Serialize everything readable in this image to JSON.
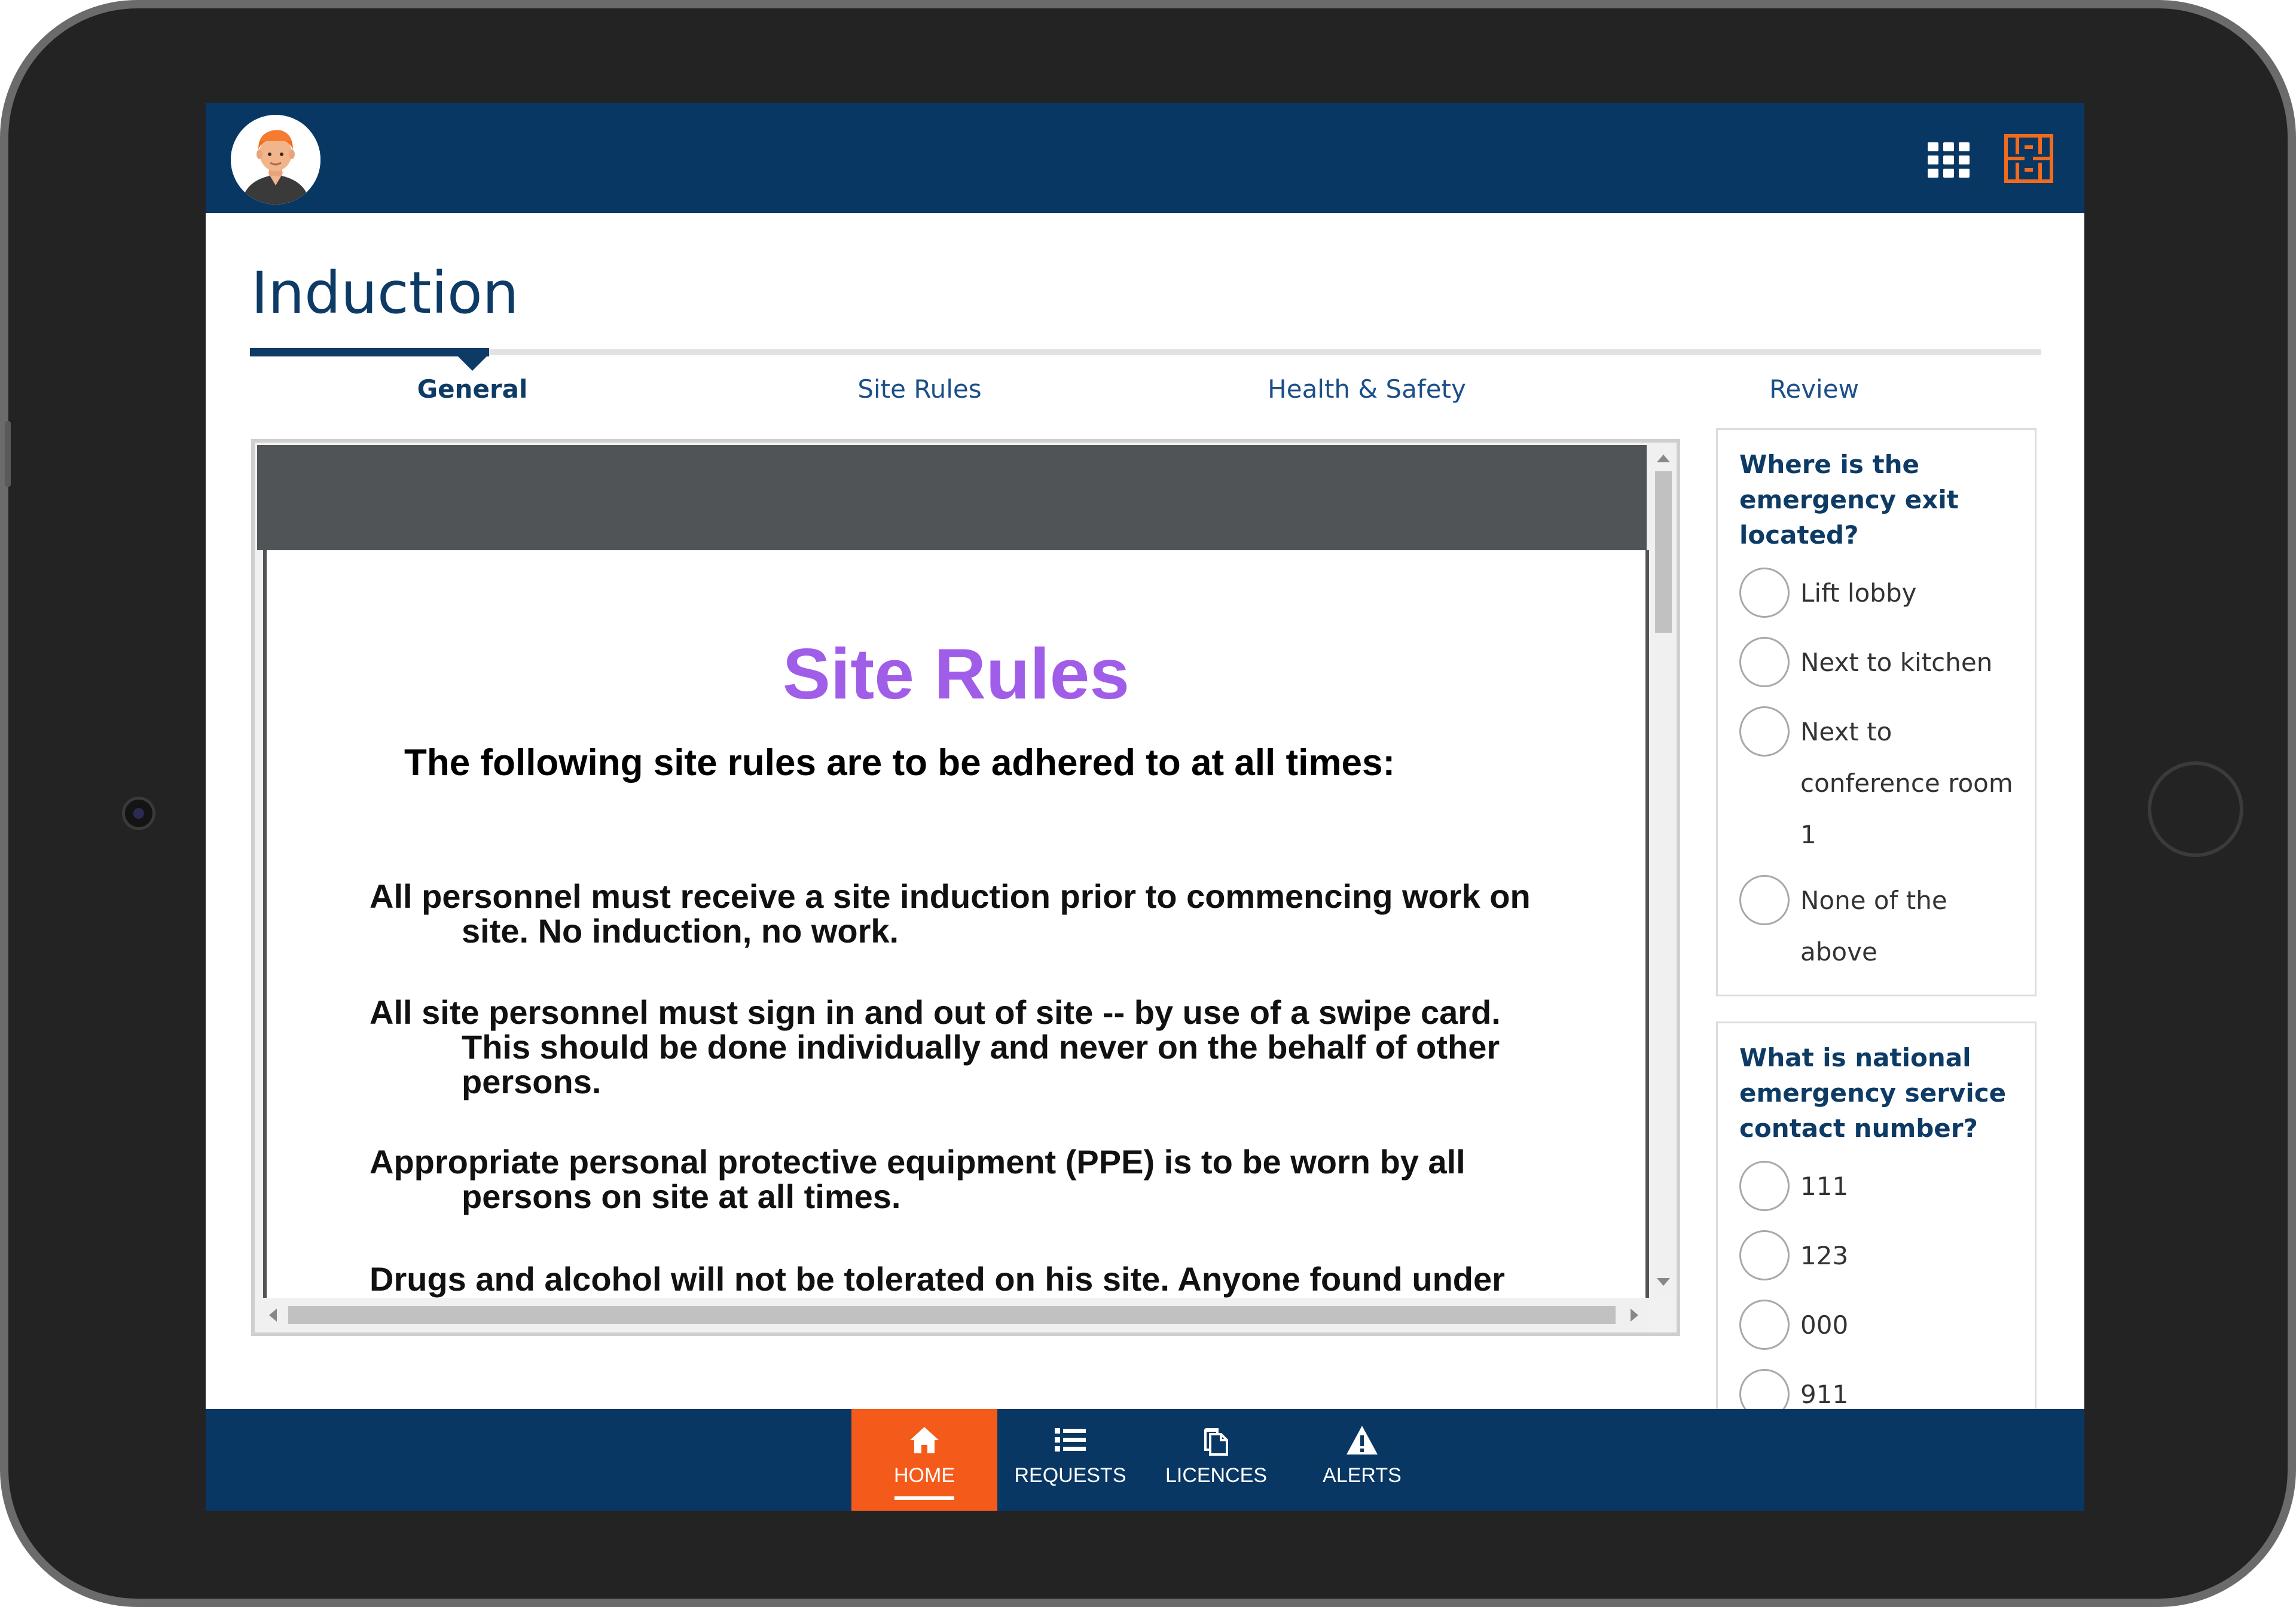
{
  "header": {
    "avatar_alt": "user-avatar",
    "apps_icon": "grid-apps-icon",
    "logo_icon": "brand-logo-icon",
    "brand_color": "#093764",
    "accent_color": "#f45b1b"
  },
  "page": {
    "title": "Induction"
  },
  "steps": [
    {
      "label": "General",
      "active": true
    },
    {
      "label": "Site Rules",
      "active": false
    },
    {
      "label": "Health & Safety",
      "active": false
    },
    {
      "label": "Review",
      "active": false
    }
  ],
  "document": {
    "title": "Site Rules",
    "subtitle": "The following site rules are to be adhered to at all times:",
    "rules": [
      {
        "first": "All personnel must receive a site induction prior to commencing work on",
        "rest": [
          "site. No induction, no work."
        ]
      },
      {
        "first": "All site personnel must sign in and out of site -- by use of a swipe card.",
        "rest": [
          "This should be done individually and never on the behalf of other",
          "persons."
        ]
      },
      {
        "first": "Appropriate personal protective equipment (PPE) is to be worn by all",
        "rest": [
          "persons on site at all times."
        ]
      },
      {
        "first": "Drugs and alcohol will not be tolerated on his site. Anyone found under",
        "rest": []
      }
    ]
  },
  "questions": [
    {
      "question": "Where is the emergency exit located?",
      "options": [
        "Lift lobby",
        "Next to kitchen",
        "Next to conference room 1",
        "None of the above"
      ]
    },
    {
      "question": "What is national emergency service contact number?",
      "options": [
        "111",
        "123",
        "000",
        "911"
      ]
    }
  ],
  "nav": {
    "home": "HOME",
    "requests": "REQUESTS",
    "licences": "LICENCES",
    "alerts": "ALERTS"
  }
}
